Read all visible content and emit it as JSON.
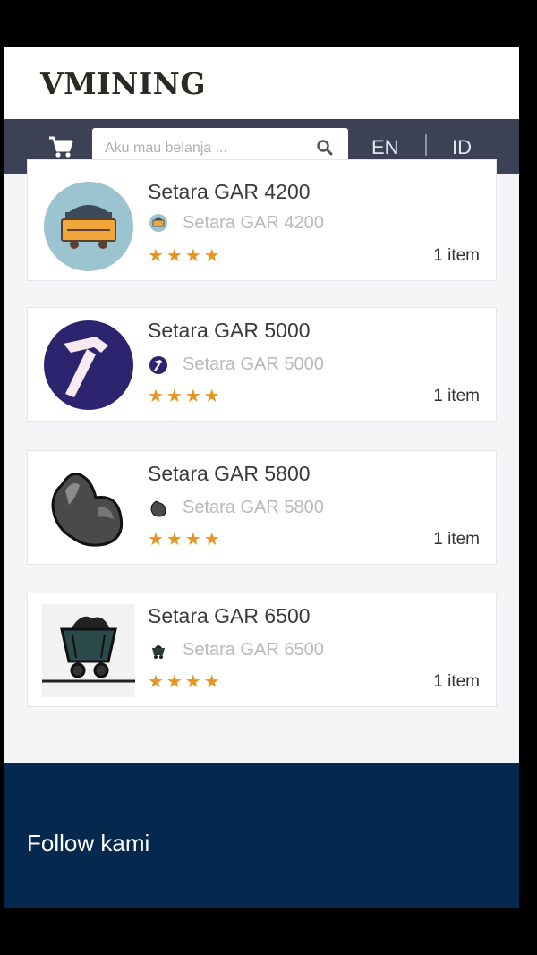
{
  "brand": {
    "logo_text": "VMINING"
  },
  "nav": {
    "cart_icon": "cart-icon",
    "search_placeholder": "Aku mau belanja ...",
    "search_icon": "search-icon",
    "lang_en": "EN",
    "lang_separator": "|",
    "lang_id": "ID"
  },
  "products": [
    {
      "title": "Setara GAR 4200",
      "subtitle": "Setara GAR 4200",
      "stars": "★★★★",
      "count": "1 item",
      "icon": "coal-cart-icon"
    },
    {
      "title": "Setara GAR 5000",
      "subtitle": "Setara GAR 5000",
      "stars": "★★★★",
      "count": "1 item",
      "icon": "hammer-icon"
    },
    {
      "title": "Setara GAR 5800",
      "subtitle": "Setara GAR 5800",
      "stars": "★★★★",
      "count": "1 item",
      "icon": "coal-lump-icon"
    },
    {
      "title": "Setara GAR 6500",
      "subtitle": "Setara GAR 6500",
      "stars": "★★★★",
      "count": "1 item",
      "icon": "mine-cart-icon"
    }
  ],
  "footer": {
    "follow_label": "Follow kami"
  },
  "colors": {
    "nav_bg": "#3c4155",
    "footer_bg": "#05294e",
    "star": "#e69620"
  }
}
